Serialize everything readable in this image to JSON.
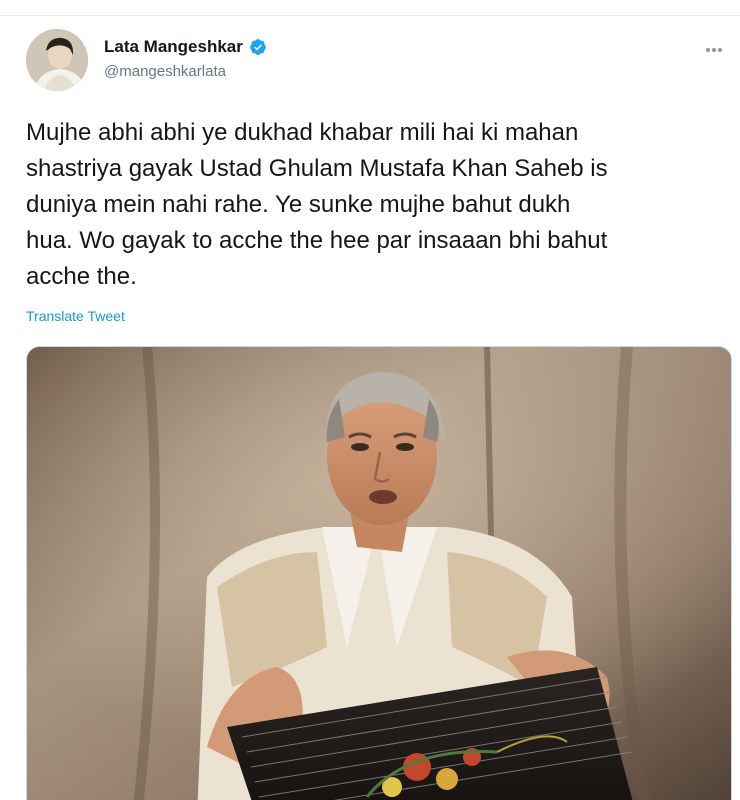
{
  "tweet": {
    "author": {
      "display_name": "Lata Mangeshkar",
      "handle": "@mangeshkarlata",
      "verified_icon": "verified-badge-icon",
      "verified_color": "#1da1f2"
    },
    "text": "Mujhe abhi abhi ye dukhad khabar mili hai ki mahan\nshastriya gayak Ustad Ghulam Mustafa Khan Saheb is\nduniya mein nahi rahe. Ye sunke mujhe bahut dukh\nhua. Wo gayak to acche the hee par insaaan bhi bahut\nacche the.",
    "translate_label": "Translate Tweet",
    "more_icon": "more-options-icon"
  },
  "colors": {
    "link": "#1b95e0",
    "secondary_text": "#657786",
    "primary_text": "#14171a"
  }
}
